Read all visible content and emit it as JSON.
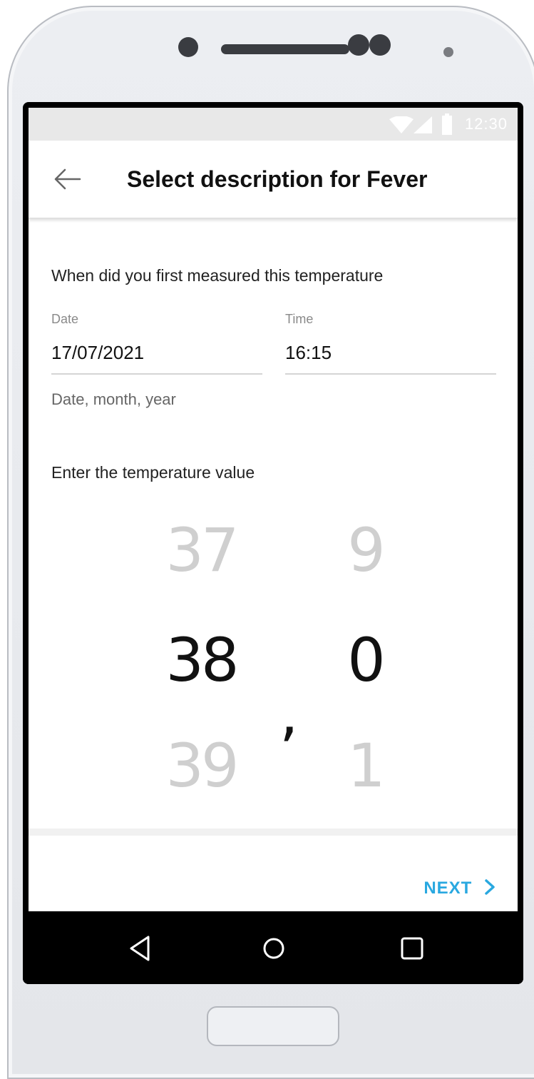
{
  "status_bar": {
    "time": "12:30"
  },
  "header": {
    "title": "Select description for Fever"
  },
  "measurement": {
    "question": "When did you first measured this temperature",
    "date": {
      "label": "Date",
      "value": "17/07/2021",
      "helper": "Date, month, year"
    },
    "time": {
      "label": "Time",
      "value": "16:15"
    }
  },
  "temperature": {
    "prompt": "Enter the temperature value",
    "integer_picker": {
      "above": "37",
      "selected": "38",
      "below": "39"
    },
    "separator": ",",
    "decimal_picker": {
      "above": "9",
      "selected": "0",
      "below": "1"
    }
  },
  "footer": {
    "next_label": "NEXT"
  },
  "colors": {
    "accent": "#29a8e0",
    "status_bar": "#e8e8e8",
    "dim_text": "#cfcfcf"
  }
}
